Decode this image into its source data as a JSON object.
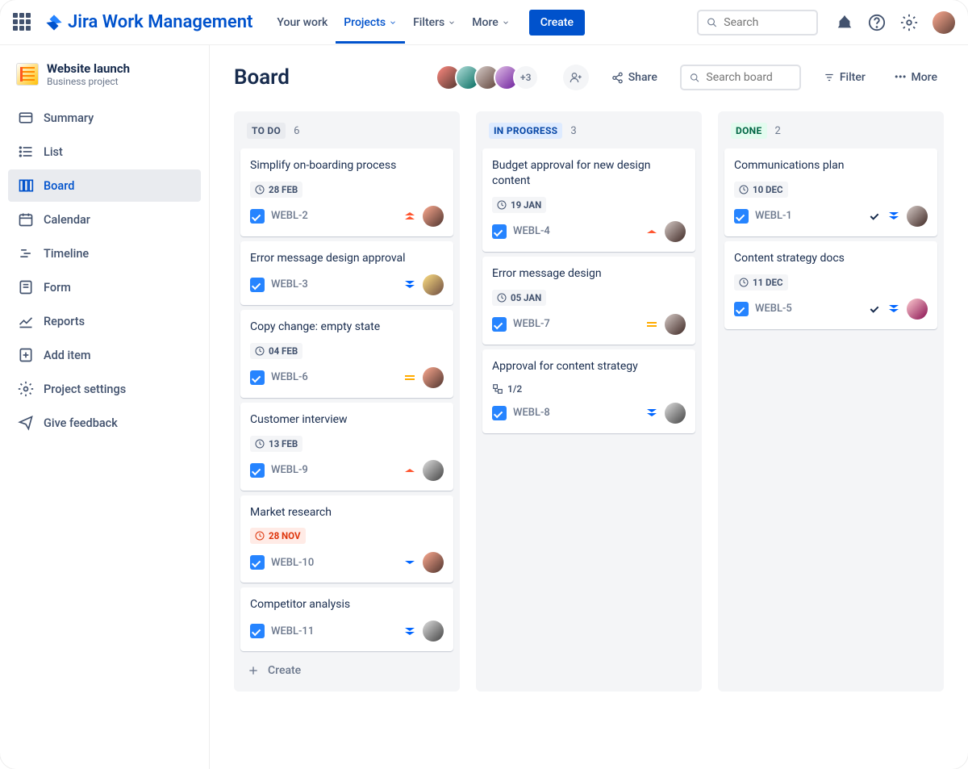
{
  "topnav": {
    "product": "Jira Work Management",
    "items": [
      "Your work",
      "Projects",
      "Filters",
      "More"
    ],
    "active": "Projects",
    "create": "Create",
    "search_placeholder": "Search"
  },
  "project": {
    "name": "Website launch",
    "type": "Business project"
  },
  "sidebar": {
    "items": [
      {
        "label": "Summary",
        "icon": "summary"
      },
      {
        "label": "List",
        "icon": "list"
      },
      {
        "label": "Board",
        "icon": "board",
        "active": true
      },
      {
        "label": "Calendar",
        "icon": "calendar"
      },
      {
        "label": "Timeline",
        "icon": "timeline"
      },
      {
        "label": "Form",
        "icon": "form"
      },
      {
        "label": "Reports",
        "icon": "reports"
      },
      {
        "label": "Add item",
        "icon": "add"
      },
      {
        "label": "Project settings",
        "icon": "settings"
      },
      {
        "label": "Give feedback",
        "icon": "feedback"
      }
    ]
  },
  "board": {
    "title": "Board",
    "avatar_overflow": "+3",
    "share": "Share",
    "search_placeholder": "Search board",
    "filter": "Filter",
    "more": "More",
    "create_card": "Create"
  },
  "columns": [
    {
      "key": "todo",
      "title": "TO DO",
      "count": 6,
      "style": "todo",
      "cards": [
        {
          "title": "Simplify on-boarding process",
          "date": "28 FEB",
          "key": "WEBL-2",
          "priority": "highest",
          "av": "av-a"
        },
        {
          "title": "Error message design approval",
          "key": "WEBL-3",
          "priority": "lowest",
          "av": "av-b"
        },
        {
          "title": "Copy change: empty state",
          "date": "04 FEB",
          "key": "WEBL-6",
          "priority": "medium",
          "av": "av-a"
        },
        {
          "title": "Customer interview",
          "date": "13 FEB",
          "key": "WEBL-9",
          "priority": "high",
          "av": "av-c"
        },
        {
          "title": "Market research",
          "date": "28 NOV",
          "overdue": true,
          "key": "WEBL-10",
          "priority": "low",
          "av": "av-a"
        },
        {
          "title": "Competitor analysis",
          "key": "WEBL-11",
          "priority": "lowest",
          "av": "av-c"
        }
      ],
      "show_create": true
    },
    {
      "key": "progress",
      "title": "IN PROGRESS",
      "count": 3,
      "style": "progress",
      "cards": [
        {
          "title": "Budget approval for new design content",
          "date": "19 JAN",
          "key": "WEBL-4",
          "priority": "high",
          "av": "av-d"
        },
        {
          "title": "Error message design",
          "date": "05 JAN",
          "key": "WEBL-7",
          "priority": "medium",
          "av": "av-d"
        },
        {
          "title": "Approval for content strategy",
          "subtask": "1/2",
          "key": "WEBL-8",
          "priority": "lowest",
          "av": "av-c"
        }
      ]
    },
    {
      "key": "done",
      "title": "DONE",
      "count": 2,
      "style": "done",
      "cards": [
        {
          "title": "Communications plan",
          "date": "10 DEC",
          "key": "WEBL-1",
          "done": true,
          "priority": "lowest",
          "av": "av-d"
        },
        {
          "title": "Content strategy docs",
          "date": "11 DEC",
          "key": "WEBL-5",
          "done": true,
          "priority": "lowest",
          "av": "av-e"
        }
      ]
    }
  ]
}
